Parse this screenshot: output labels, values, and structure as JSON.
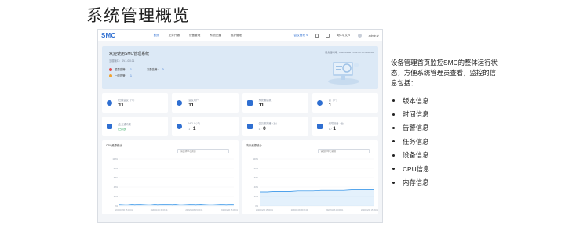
{
  "slide": {
    "title": "系统管理概览"
  },
  "app": {
    "logo": "SMC",
    "nav": [
      {
        "label": "首页",
        "active": true
      },
      {
        "label": "业务开通",
        "active": false
      },
      {
        "label": "设备管理",
        "active": false
      },
      {
        "label": "系统配置",
        "active": false
      },
      {
        "label": "维护管理",
        "active": false
      }
    ],
    "topright": {
      "site": "会议管理 ∨",
      "language": "简体中文 ∨",
      "user": "admin ∨"
    },
    "welcome": {
      "title": "欢迎使用SMC管理系统",
      "version": "当前版本：SV.1.0.0.01",
      "time": "服务器时间：2020/01/06 15:01:23  UTC+08:00",
      "alerts": [
        {
          "label": "重要告警：",
          "count": "1",
          "level": "red"
        },
        {
          "label": "次要告警：",
          "count": "0",
          "level": "none"
        },
        {
          "label": "一般告警：",
          "count": "1",
          "level": "orange"
        }
      ]
    },
    "cards": [
      {
        "label": "在线会议（个）",
        "value": "11",
        "icon": "meeting-icon"
      },
      {
        "label": "会议用户",
        "value": "11",
        "icon": "user-icon"
      },
      {
        "label": "系统通话数",
        "value": "11",
        "icon": "call-icon"
      },
      {
        "label": "会（个）",
        "value": "1",
        "icon": "conference-icon"
      },
      {
        "label": "企业通讯录",
        "value": "已同步",
        "icon": "directory-icon"
      },
      {
        "label": "MCU（个）",
        "value": "1",
        "sub": "1 /",
        "icon": "mcu-icon"
      },
      {
        "label": "会议服务器（台）",
        "value": "0",
        "sub": "1 /",
        "icon": "server-icon"
      },
      {
        "label": "终端设备（台）",
        "value": "1",
        "sub": "1 /",
        "icon": "terminal-icon"
      }
    ],
    "charts": [
      {
        "title": "CPU资源统计",
        "select": "请选择中心资源",
        "color": "#1e88e5"
      },
      {
        "title": "内存资源统计",
        "select": "请选择中心资源",
        "color": "#1e88e5"
      }
    ]
  },
  "chart_data": [
    {
      "type": "area",
      "title": "CPU资源统计",
      "y_ticks": [
        "100%",
        "80%",
        "60%",
        "40%",
        "20%",
        "0%"
      ],
      "ylim": [
        0,
        100
      ],
      "x": [
        "2020/01/06 15:00:01",
        "2020/01/06 15:03:01",
        "2020/01/06 15:06:01",
        "2020/01/06 15:09:01"
      ],
      "series": [
        {
          "values": [
            3,
            4,
            2,
            3,
            4,
            2,
            3,
            2,
            4,
            3,
            2,
            3,
            4,
            3,
            2,
            3
          ]
        }
      ]
    },
    {
      "type": "area",
      "title": "内存资源统计",
      "y_ticks": [
        "100%",
        "80%",
        "60%",
        "40%",
        "20%",
        "0%"
      ],
      "ylim": [
        0,
        100
      ],
      "x": [
        "2020/01/06 15:00:01",
        "2020/01/06 15:03:01",
        "2020/01/06 15:06:01",
        "2020/01/06 15:09:01"
      ],
      "series": [
        {
          "values": [
            30,
            30,
            31,
            31,
            31,
            32,
            32,
            32,
            33,
            33,
            33,
            33,
            34,
            34,
            34,
            34
          ]
        }
      ]
    }
  ],
  "description": {
    "text": "设备管理首页监控SMC的整体运行状态，方便系统管理员查看，监控的信息包括：",
    "items": [
      "版本信息",
      "时间信息",
      "告警信息",
      "任务信息",
      "设备信息",
      "CPU信息",
      "内存信息"
    ]
  }
}
